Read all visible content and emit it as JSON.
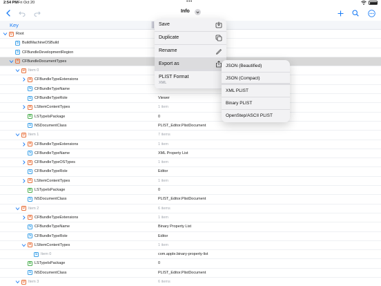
{
  "status": {
    "time": "2:54 PM",
    "date": "Fri Oct 20",
    "dots": "•••"
  },
  "nav": {
    "title": "Info"
  },
  "header": {
    "key_label": "Key"
  },
  "rows": [
    {
      "indent": 0,
      "disc": "open",
      "badge": "D",
      "key": "Root",
      "value": "",
      "dim": false
    },
    {
      "indent": 1,
      "disc": "",
      "badge": "S",
      "key": "BuildMachineOSBuild",
      "value": "",
      "dim": false
    },
    {
      "indent": 1,
      "disc": "",
      "badge": "S",
      "key": "CFBundleDevelopmentRegion",
      "value": "",
      "dim": false
    },
    {
      "indent": 1,
      "disc": "open",
      "badge": "A",
      "key": "CFBundleDocumentTypes",
      "value": "",
      "dim": false,
      "selected": true
    },
    {
      "indent": 2,
      "disc": "open",
      "badge": "D",
      "key": "Item 0",
      "value": "",
      "dim": false,
      "item": true
    },
    {
      "indent": 3,
      "disc": "closed",
      "badge": "A",
      "key": "CFBundleTypeExtensions",
      "value": "",
      "dim": false
    },
    {
      "indent": 3,
      "disc": "",
      "badge": "S",
      "key": "CFBundleTypeName",
      "value": "",
      "dim": false
    },
    {
      "indent": 3,
      "disc": "",
      "badge": "S",
      "key": "CFBundleTypeRole",
      "value": "Viewer",
      "dim": false
    },
    {
      "indent": 3,
      "disc": "closed",
      "badge": "A",
      "key": "LSItemContentTypes",
      "value": "1 item",
      "dim": true
    },
    {
      "indent": 3,
      "disc": "",
      "badge": "B",
      "key": "LSTypeIsPackage",
      "value": "0",
      "dim": false
    },
    {
      "indent": 3,
      "disc": "",
      "badge": "S",
      "key": "NSDocumentClass",
      "value": "PLIST_Editor.PlistDocument",
      "dim": false
    },
    {
      "indent": 2,
      "disc": "open",
      "badge": "D",
      "key": "Item 1",
      "value": "7 items",
      "dim": true,
      "item": true
    },
    {
      "indent": 3,
      "disc": "closed",
      "badge": "A",
      "key": "CFBundleTypeExtensions",
      "value": "1 item",
      "dim": true
    },
    {
      "indent": 3,
      "disc": "",
      "badge": "S",
      "key": "CFBundleTypeName",
      "value": "XML Property List",
      "dim": false
    },
    {
      "indent": 3,
      "disc": "closed",
      "badge": "A",
      "key": "CFBundleTypeOSTypes",
      "value": "1 item",
      "dim": true
    },
    {
      "indent": 3,
      "disc": "",
      "badge": "S",
      "key": "CFBundleTypeRole",
      "value": "Editor",
      "dim": false
    },
    {
      "indent": 3,
      "disc": "closed",
      "badge": "A",
      "key": "LSItemContentTypes",
      "value": "1 item",
      "dim": true
    },
    {
      "indent": 3,
      "disc": "",
      "badge": "B",
      "key": "LSTypeIsPackage",
      "value": "0",
      "dim": false
    },
    {
      "indent": 3,
      "disc": "",
      "badge": "S",
      "key": "NSDocumentClass",
      "value": "PLIST_Editor.PlistDocument",
      "dim": false
    },
    {
      "indent": 2,
      "disc": "open",
      "badge": "D",
      "key": "Item 2",
      "value": "6 items",
      "dim": true,
      "item": true
    },
    {
      "indent": 3,
      "disc": "closed",
      "badge": "A",
      "key": "CFBundleTypeExtensions",
      "value": "1 item",
      "dim": true
    },
    {
      "indent": 3,
      "disc": "",
      "badge": "S",
      "key": "CFBundleTypeName",
      "value": "Binary Property List",
      "dim": false
    },
    {
      "indent": 3,
      "disc": "",
      "badge": "S",
      "key": "CFBundleTypeRole",
      "value": "Editor",
      "dim": false
    },
    {
      "indent": 3,
      "disc": "open",
      "badge": "A",
      "key": "LSItemContentTypes",
      "value": "1 item",
      "dim": true
    },
    {
      "indent": 4,
      "disc": "",
      "badge": "S",
      "key": "Item 0",
      "value": "com.apple.binary-property-list",
      "dim": false,
      "item": true
    },
    {
      "indent": 3,
      "disc": "",
      "badge": "B",
      "key": "LSTypeIsPackage",
      "value": "0",
      "dim": false
    },
    {
      "indent": 3,
      "disc": "",
      "badge": "S",
      "key": "NSDocumentClass",
      "value": "PLIST_Editor.PlistDocument",
      "dim": false
    },
    {
      "indent": 2,
      "disc": "open",
      "badge": "D",
      "key": "Item 3",
      "value": "6 items",
      "dim": true,
      "item": true
    }
  ],
  "menu": {
    "save": "Save",
    "duplicate": "Duplicate",
    "rename": "Rename",
    "export_as": "Export as",
    "format_title": "PLIST Format",
    "format_value": "XML"
  },
  "submenu": {
    "json_beautified": "JSON (Beautified)",
    "json_compact": "JSON (Compact)",
    "xml_plist": "XML PLIST",
    "binary_plist": "Binary PLIST",
    "openstep_plist": "OpenStep/ASCII PLIST"
  },
  "colors": {
    "accent": "#1a7cf5",
    "string_badge": "#3aa0e8",
    "container_badge": "#e8703a",
    "bool_badge": "#4caf50"
  }
}
